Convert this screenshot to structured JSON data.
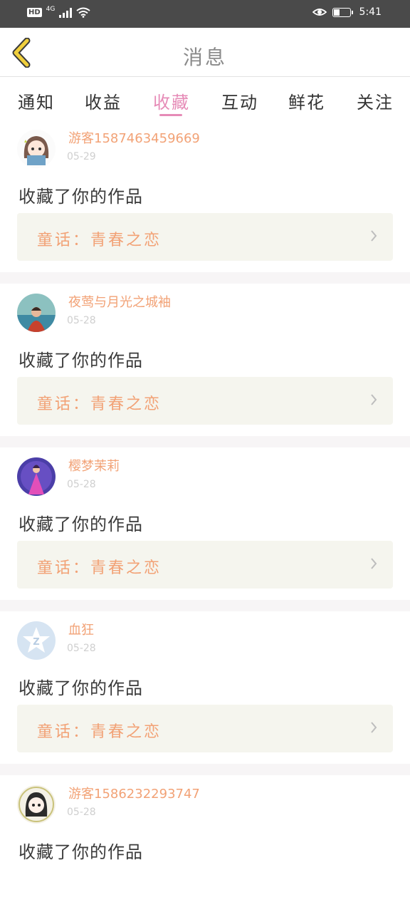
{
  "status_bar": {
    "hd": "HD",
    "network": "4G",
    "time": "5:41"
  },
  "header": {
    "title": "消息"
  },
  "tabs": [
    {
      "label": "通知"
    },
    {
      "label": "收益"
    },
    {
      "label": "收藏",
      "active": true
    },
    {
      "label": "互动"
    },
    {
      "label": "鲜花"
    },
    {
      "label": "关注"
    }
  ],
  "messages": [
    {
      "user": "游客15874634596​69",
      "date": "05-29",
      "action": "收藏了你的作品",
      "work": "童话：青春之恋",
      "avatar_icon": "cartoon-girl-avatar"
    },
    {
      "user": "夜莺与月光之城袖",
      "date": "05-28",
      "action": "收藏了你的作品",
      "work": "童话：青春之恋",
      "avatar_icon": "photo-avatar"
    },
    {
      "user": "樱梦茉莉",
      "date": "05-28",
      "action": "收藏了你的作品",
      "work": "童话：青春之恋",
      "avatar_icon": "princess-avatar"
    },
    {
      "user": "血狂",
      "date": "05-28",
      "action": "收藏了你的作品",
      "work": "童话：青春之恋",
      "avatar_icon": "qq-default-avatar"
    },
    {
      "user": "游客15862322937​47",
      "date": "05-28",
      "action": "收藏了你的作品",
      "work": "童话：青春之恋",
      "avatar_icon": "anime-girl-avatar"
    }
  ],
  "colors": {
    "accent_pink": "#e68bb7",
    "accent_orange": "#f2a276",
    "back_yellow": "#f0cf3c",
    "status_bg": "#4a4a4a"
  }
}
